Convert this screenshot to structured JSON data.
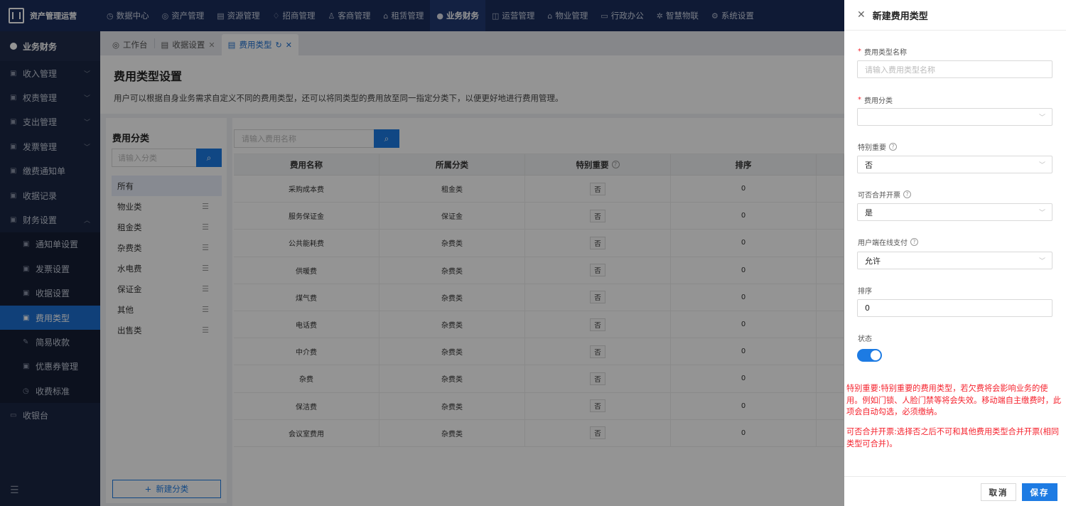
{
  "brand": {
    "name": "资产管理运营"
  },
  "topnav": [
    {
      "icon": "◷",
      "label": "数据中心"
    },
    {
      "icon": "◎",
      "label": "资产管理"
    },
    {
      "icon": "▤",
      "label": "资源管理"
    },
    {
      "icon": "♢",
      "label": "招商管理"
    },
    {
      "icon": "♙",
      "label": "客商管理"
    },
    {
      "icon": "⌂",
      "label": "租赁管理"
    },
    {
      "icon": "●",
      "label": "业务财务"
    },
    {
      "icon": "◫",
      "label": "运营管理"
    },
    {
      "icon": "⌂",
      "label": "物业管理"
    },
    {
      "icon": "▭",
      "label": "行政办公"
    },
    {
      "icon": "✲",
      "label": "智慧物联"
    },
    {
      "icon": "⚙",
      "label": "系统设置"
    }
  ],
  "sidebar": {
    "header": "业务财务",
    "items": [
      {
        "icon": "▣",
        "label": "收入管理",
        "chevron": "﹀"
      },
      {
        "icon": "▣",
        "label": "权责管理",
        "chevron": "﹀"
      },
      {
        "icon": "▣",
        "label": "支出管理",
        "chevron": "﹀"
      },
      {
        "icon": "▣",
        "label": "发票管理",
        "chevron": "﹀"
      },
      {
        "icon": "▣",
        "label": "缴费通知单",
        "chevron": ""
      },
      {
        "icon": "▣",
        "label": "收据记录",
        "chevron": ""
      },
      {
        "icon": "▣",
        "label": "财务设置",
        "chevron": "︿"
      }
    ],
    "subitems": [
      {
        "icon": "▣",
        "label": "通知单设置"
      },
      {
        "icon": "▣",
        "label": "发票设置"
      },
      {
        "icon": "▣",
        "label": "收据设置"
      },
      {
        "icon": "▣",
        "label": "费用类型"
      },
      {
        "icon": "✎",
        "label": "简易收款"
      },
      {
        "icon": "▣",
        "label": "优惠券管理"
      },
      {
        "icon": "◷",
        "label": "收费标准"
      }
    ],
    "cashier": {
      "icon": "▭",
      "label": "收银台"
    },
    "collapse_icon": "☰"
  },
  "tabs": [
    {
      "icon": "◎",
      "label": "工作台"
    },
    {
      "icon": "▤",
      "label": "收据设置",
      "close": "✕"
    },
    {
      "icon": "▤",
      "label": "费用类型",
      "close": "✕",
      "refresh": "↻"
    }
  ],
  "page": {
    "title": "费用类型设置",
    "description": "用户可以根据自身业务需求自定义不同的费用类型，还可以将同类型的费用放至同一指定分类下，以便更好地进行费用管理。"
  },
  "categories": {
    "title": "费用分类",
    "search_placeholder": "请输入分类",
    "search_icon": "⌕",
    "items": [
      "所有",
      "物业类",
      "租金类",
      "杂费类",
      "水电费",
      "保证金",
      "其他",
      "出售类"
    ],
    "menu_icon": "☰",
    "new_button": "新建分类",
    "new_icon": "+"
  },
  "fees": {
    "search_placeholder": "请输入费用名称",
    "columns": [
      "费用名称",
      "所属分类",
      "特别重要",
      "排序"
    ],
    "help_icon": "?",
    "rows": [
      {
        "name": "采购成本费",
        "category": "租金类",
        "important": "否",
        "sort": "0"
      },
      {
        "name": "服务保证金",
        "category": "保证金",
        "important": "否",
        "sort": "0"
      },
      {
        "name": "公共能耗费",
        "category": "杂费类",
        "important": "否",
        "sort": "0"
      },
      {
        "name": "供暖费",
        "category": "杂费类",
        "important": "否",
        "sort": "0"
      },
      {
        "name": "煤气费",
        "category": "杂费类",
        "important": "否",
        "sort": "0"
      },
      {
        "name": "电话费",
        "category": "杂费类",
        "important": "否",
        "sort": "0"
      },
      {
        "name": "中介费",
        "category": "杂费类",
        "important": "否",
        "sort": "0"
      },
      {
        "name": "杂费",
        "category": "杂费类",
        "important": "否",
        "sort": "0"
      },
      {
        "name": "保洁费",
        "category": "杂费类",
        "important": "否",
        "sort": "0"
      },
      {
        "name": "会议室费用",
        "category": "杂费类",
        "important": "否",
        "sort": "0"
      }
    ]
  },
  "drawer": {
    "title": "新建费用类型",
    "close_icon": "✕",
    "fields": {
      "name_label": "费用类型名称",
      "name_placeholder": "请输入费用类型名称",
      "category_label": "费用分类",
      "category_value": "",
      "important_label": "特别重要",
      "important_value": "否",
      "merge_label": "可否合并开票",
      "merge_value": "是",
      "online_label": "用户端在线支付",
      "online_value": "允许",
      "sort_label": "排序",
      "sort_value": "0",
      "status_label": "状态",
      "status_on": true,
      "required_mark": "*",
      "select_arrow": "﹀"
    },
    "note_important": "特别重要:特别重要的费用类型，若欠费将会影响业务的使用。例如门锁、人脸门禁等将会失效。移动端自主缴费时，此项会自动勾选，必须缴纳。",
    "note_merge": "可否合并开票:选择否之后不可和其他费用类型合并开票(相同类型可合并)。",
    "cancel_label": "取消",
    "save_label": "保存"
  }
}
